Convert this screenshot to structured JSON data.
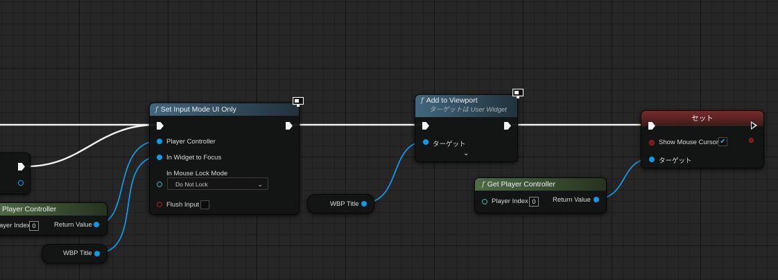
{
  "nodes": {
    "partial_top": {},
    "set_input_mode": {
      "title": "Set Input Mode UI Only",
      "pins": {
        "player_controller": "Player Controller",
        "in_widget_to_focus": "In Widget to Focus",
        "in_mouse_lock_mode": "In Mouse Lock Mode",
        "mouse_lock_value": "Do Not Lock",
        "flush_input": "Flush Input"
      }
    },
    "add_to_viewport": {
      "title": "Add to Viewport",
      "subtitle": "ターゲットは User Widget",
      "pins": {
        "target": "ターゲット"
      }
    },
    "set_node": {
      "title": "セット",
      "pins": {
        "show_mouse_cursor": "Show Mouse Cursor",
        "target": "ターゲット"
      }
    },
    "get_player_controller_right": {
      "title": "Get Player Controller",
      "pins": {
        "player_index": "Player Index",
        "player_index_value": "0",
        "return_value": "Return Value"
      }
    },
    "get_player_controller_left": {
      "title": "Player Controller",
      "pins": {
        "player_index": "ayer Index",
        "player_index_value": "0",
        "return_value": "Return Value"
      }
    },
    "wbp_title_left": {
      "label": "WBP Title"
    },
    "wbp_title_mid": {
      "label": "WBP Title"
    }
  },
  "colors": {
    "exec_wire": "#f2f2f2",
    "object_wire": "#0f9ae8",
    "function_header": "#41677e",
    "pure_header": "#4d6b44",
    "set_header": "#7a2a2a"
  }
}
